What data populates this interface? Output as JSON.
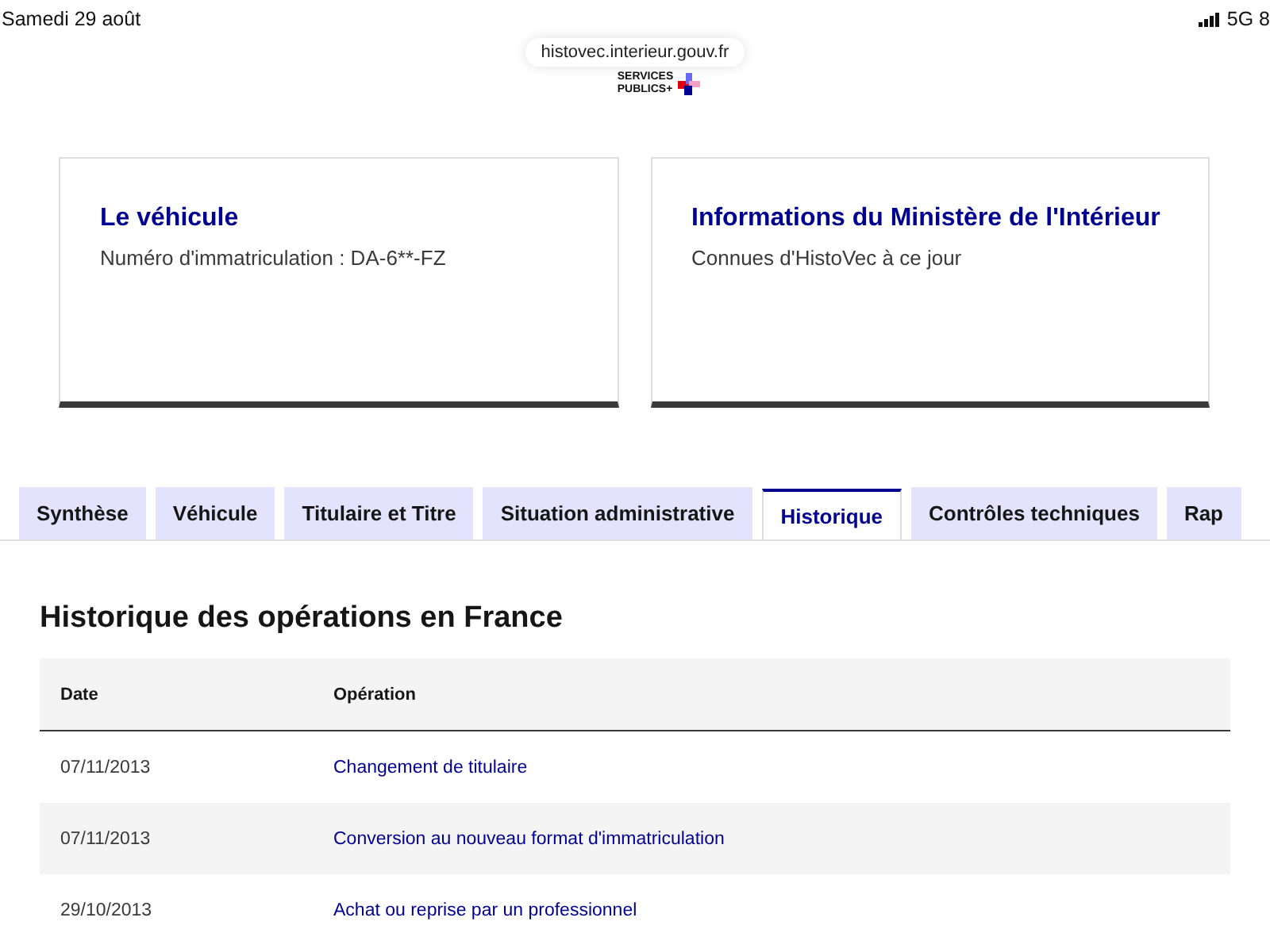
{
  "status_bar": {
    "date": "Samedi 29 août",
    "network": "5G 8"
  },
  "browser": {
    "url": "histovec.interieur.gouv.fr",
    "logo_text": [
      "SERVICES",
      "PUBLICS+"
    ]
  },
  "cards": [
    {
      "title": "Le véhicule",
      "subtitle": "Numéro d'immatriculation : DA-6**-FZ"
    },
    {
      "title": "Informations du Ministère de l'Intérieur",
      "subtitle": "Connues d'HistoVec à ce jour"
    }
  ],
  "tabs": [
    {
      "label": "Synthèse",
      "selected": false
    },
    {
      "label": "Véhicule",
      "selected": false
    },
    {
      "label": "Titulaire et Titre",
      "selected": false
    },
    {
      "label": "Situation administrative",
      "selected": false
    },
    {
      "label": "Historique",
      "selected": true
    },
    {
      "label": "Contrôles techniques",
      "selected": false
    },
    {
      "label": "Rap",
      "selected": false
    }
  ],
  "section": {
    "title": "Historique des opérations en France",
    "table": {
      "columns": [
        "Date",
        "Opération"
      ],
      "rows": [
        {
          "date": "07/11/2013",
          "operation": "Changement de titulaire"
        },
        {
          "date": "07/11/2013",
          "operation": "Conversion au nouveau format d'immatriculation"
        },
        {
          "date": "29/10/2013",
          "operation": "Achat ou reprise par un professionnel"
        }
      ]
    }
  }
}
